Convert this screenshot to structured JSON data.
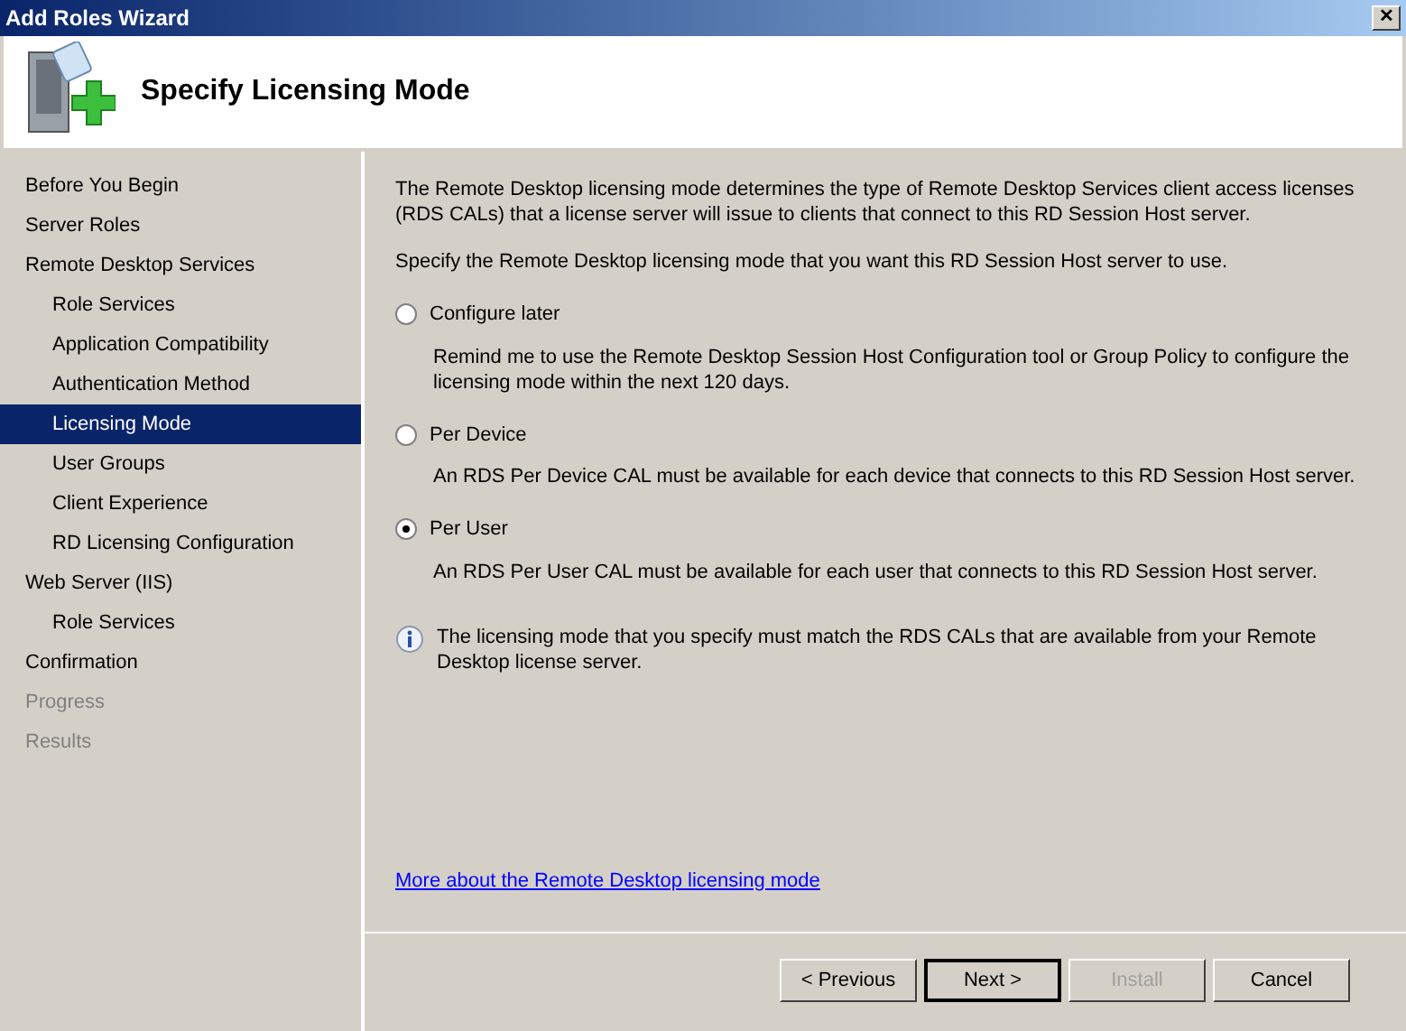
{
  "window": {
    "title": "Add Roles Wizard",
    "close": "✕"
  },
  "header": {
    "title": "Specify Licensing Mode"
  },
  "sidebar": {
    "items": [
      {
        "label": "Before You Begin",
        "selected": false,
        "disabled": false
      },
      {
        "label": "Server Roles",
        "selected": false,
        "disabled": false
      },
      {
        "label": "Remote Desktop Services",
        "selected": false,
        "disabled": false,
        "children": [
          {
            "label": "Role Services",
            "selected": false,
            "disabled": false
          },
          {
            "label": "Application Compatibility",
            "selected": false,
            "disabled": false
          },
          {
            "label": "Authentication Method",
            "selected": false,
            "disabled": false
          },
          {
            "label": "Licensing Mode",
            "selected": true,
            "disabled": false
          },
          {
            "label": "User Groups",
            "selected": false,
            "disabled": false
          },
          {
            "label": "Client Experience",
            "selected": false,
            "disabled": false
          },
          {
            "label": "RD Licensing Configuration",
            "selected": false,
            "disabled": false
          }
        ]
      },
      {
        "label": "Web Server (IIS)",
        "selected": false,
        "disabled": false,
        "children": [
          {
            "label": "Role Services",
            "selected": false,
            "disabled": false
          }
        ]
      },
      {
        "label": "Confirmation",
        "selected": false,
        "disabled": false
      },
      {
        "label": "Progress",
        "selected": false,
        "disabled": true
      },
      {
        "label": "Results",
        "selected": false,
        "disabled": true
      }
    ]
  },
  "content": {
    "intro": "The Remote Desktop licensing mode determines the type of Remote Desktop Services client access licenses (RDS CALs) that a license server will issue to clients that connect to this RD Session Host server.",
    "prompt": "Specify the Remote Desktop licensing mode that you want this RD Session Host server to use.",
    "options": [
      {
        "label": "Configure later",
        "description": "Remind me to use the Remote Desktop Session Host Configuration tool or Group Policy to configure the licensing mode within the next 120 days.",
        "selected": false
      },
      {
        "label": "Per Device",
        "description": "An RDS Per Device CAL must be available for each device that connects to this RD Session Host server.",
        "selected": false
      },
      {
        "label": "Per User",
        "description": "An RDS Per User CAL must be available for each user that connects to this RD Session Host server.",
        "selected": true
      }
    ],
    "info": "The licensing mode that you specify must match the RDS CALs that are available from your Remote Desktop license server.",
    "link": "More about the Remote Desktop licensing mode"
  },
  "buttons": [
    {
      "label": "< Previous",
      "disabled": false,
      "default": false
    },
    {
      "label": "Next >",
      "disabled": false,
      "default": true
    },
    {
      "label": "Install",
      "disabled": true,
      "default": false
    },
    {
      "label": "Cancel",
      "disabled": false,
      "default": false
    }
  ]
}
